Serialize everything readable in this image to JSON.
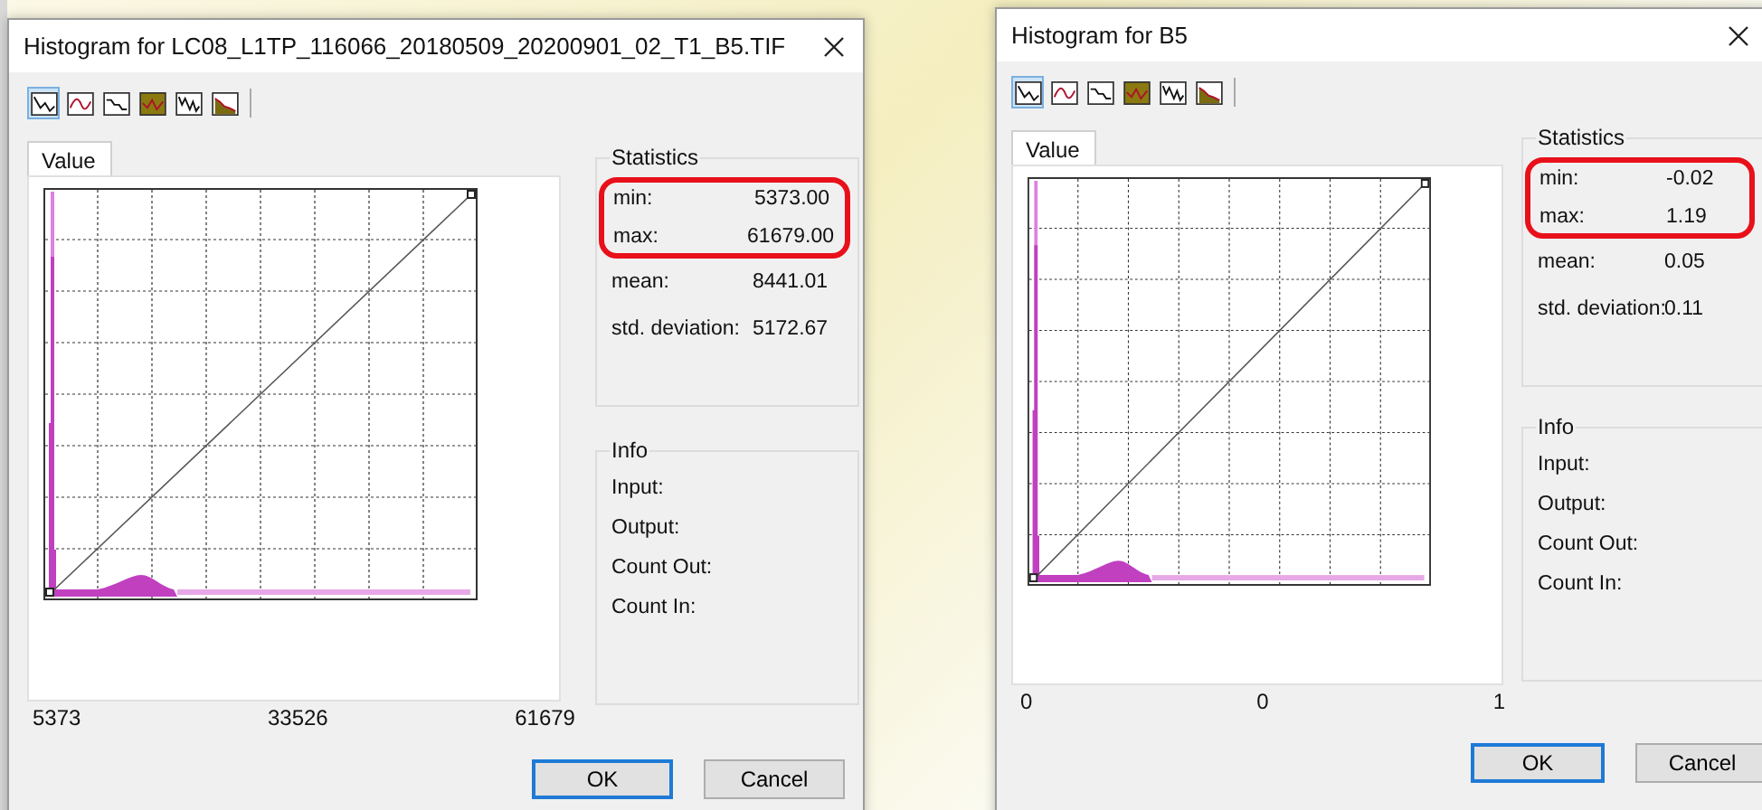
{
  "dialogs": [
    {
      "title": "Histogram for LC08_L1TP_116066_20180509_20200901_02_T1_B5.TIF",
      "toolbar": [
        {
          "kind": "line",
          "selected": true
        },
        {
          "kind": "smooth",
          "selected": false
        },
        {
          "kind": "step",
          "selected": false
        },
        {
          "kind": "band",
          "selected": false
        },
        {
          "kind": "jagged",
          "selected": false
        },
        {
          "kind": "area",
          "selected": false
        }
      ],
      "tab": {
        "label": "Value",
        "selected": true
      },
      "axis_labels": [
        "5373",
        "33526",
        "61679"
      ],
      "statistics": {
        "title": "Statistics",
        "rows": [
          {
            "label": "min:",
            "value": "5373.00",
            "highlighted": true
          },
          {
            "label": "max:",
            "value": "61679.00",
            "highlighted": true
          },
          {
            "label": "mean:",
            "value": "8441.01",
            "highlighted": false
          },
          {
            "label": "std. deviation:",
            "value": "5172.67",
            "highlighted": false
          }
        ]
      },
      "info": {
        "title": "Info",
        "labels": [
          "Input:",
          "Output:",
          "Count Out:",
          "Count In:"
        ]
      },
      "buttons": [
        {
          "label": "OK",
          "default": true
        },
        {
          "label": "Cancel",
          "default": false
        }
      ]
    },
    {
      "title": "Histogram for B5",
      "toolbar": [
        {
          "kind": "line",
          "selected": true
        },
        {
          "kind": "smooth",
          "selected": false
        },
        {
          "kind": "step",
          "selected": false
        },
        {
          "kind": "band",
          "selected": false
        },
        {
          "kind": "jagged",
          "selected": false
        },
        {
          "kind": "area",
          "selected": false
        }
      ],
      "tab": {
        "label": "Value",
        "selected": true
      },
      "axis_labels": [
        "0",
        "0",
        "1"
      ],
      "statistics": {
        "title": "Statistics",
        "rows": [
          {
            "label": "min:",
            "value": "-0.02",
            "highlighted": true
          },
          {
            "label": "max:",
            "value": "1.19",
            "highlighted": true
          },
          {
            "label": "mean:",
            "value": "0.05",
            "highlighted": false
          },
          {
            "label": "std. deviation:",
            "value": "0.11",
            "highlighted": false
          }
        ]
      },
      "info": {
        "title": "Info",
        "labels": [
          "Input:",
          "Output:",
          "Count Out:",
          "Count In:"
        ]
      },
      "buttons": [
        {
          "label": "OK",
          "default": true
        },
        {
          "label": "Cancel",
          "default": false
        }
      ]
    }
  ]
}
